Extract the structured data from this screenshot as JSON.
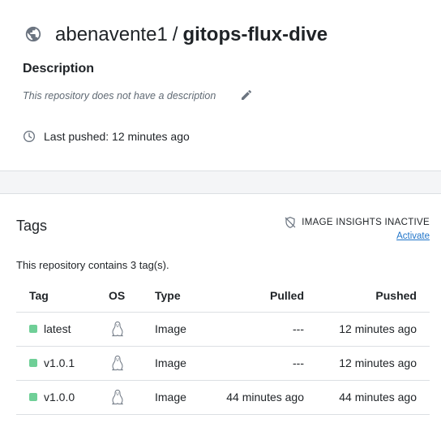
{
  "repo": {
    "owner": "abenavente1",
    "separator": "/",
    "name": "gitops-flux-dive"
  },
  "description": {
    "heading": "Description",
    "text": "This repository does not have a description"
  },
  "last_pushed": "Last pushed: 12 minutes ago",
  "tags_section": {
    "heading": "Tags",
    "insights_status": "IMAGE INSIGHTS INACTIVE",
    "activate_link": "Activate",
    "count_text": "This repository contains 3 tag(s).",
    "columns": {
      "tag": "Tag",
      "os": "OS",
      "type": "Type",
      "pulled": "Pulled",
      "pushed": "Pushed"
    },
    "rows": [
      {
        "tag": "latest",
        "os_icon": "linux-icon",
        "type": "Image",
        "pulled": "---",
        "pushed": "12 minutes ago"
      },
      {
        "tag": "v1.0.1",
        "os_icon": "linux-icon",
        "type": "Image",
        "pulled": "---",
        "pushed": "12 minutes ago"
      },
      {
        "tag": "v1.0.0",
        "os_icon": "linux-icon",
        "type": "Image",
        "pulled": "44 minutes ago",
        "pushed": "44 minutes ago"
      }
    ]
  },
  "colors": {
    "tag_status": "#6fcf97",
    "link": "#1f74c9",
    "icon": "#6b7480"
  }
}
